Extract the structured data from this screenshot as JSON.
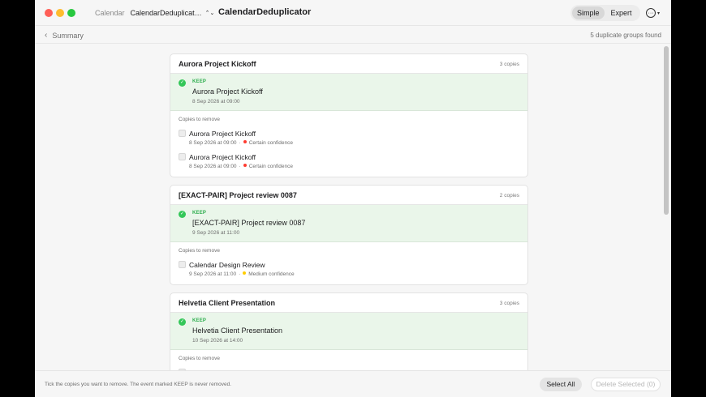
{
  "titlebar": {
    "calendar_label": "Calendar",
    "calendar_value": "CalendarDeduplicat…",
    "app_title": "CalendarDeduplicator",
    "modes": [
      "Simple",
      "Expert"
    ],
    "active_mode": "Simple",
    "more_icon": "ellipsis-circle-icon",
    "more_glyph": "···",
    "more_chevron": "▾",
    "updown_glyph": "⌃⌄"
  },
  "subheader": {
    "back_chevron": "‹",
    "back_label": "Summary",
    "groups_found": "5 duplicate groups found"
  },
  "groups": [
    {
      "title": "Aurora Project Kickoff",
      "copies": "3 copies",
      "keep": {
        "tag": "KEEP",
        "title": "Aurora Project Kickoff",
        "date": "8 Sep 2026 at 09:00"
      },
      "remove_label": "Copies to remove",
      "copies_to_remove": [
        {
          "title": "Aurora Project Kickoff",
          "date": "8 Sep 2026 at 09:00",
          "confidence": "Certain confidence"
        },
        {
          "title": "Aurora Project Kickoff",
          "date": "8 Sep 2026 at 09:00",
          "confidence": "Certain confidence"
        }
      ]
    },
    {
      "title": "[EXACT-PAIR] Project review 0087",
      "copies": "2 copies",
      "keep": {
        "tag": "KEEP",
        "title": "[EXACT-PAIR] Project review 0087",
        "date": "9 Sep 2026 at 11:00"
      },
      "remove_label": "Copies to remove",
      "copies_to_remove": [
        {
          "title": "Calendar Design Review",
          "date": "9 Sep 2026 at 11:00",
          "confidence": "Medium confidence"
        }
      ]
    },
    {
      "title": "Helvetia Client Presentation",
      "copies": "3 copies",
      "keep": {
        "tag": "KEEP",
        "title": "Helvetia Client Presentation",
        "date": "10 Sep 2026 at 14:00"
      },
      "remove_label": "Copies to remove",
      "copies_to_remove": []
    }
  ],
  "colors": {
    "certain": "#ff3b30",
    "medium": "#ffcc00",
    "keep_green": "#34c759"
  },
  "footer": {
    "note": "Tick the copies you want to remove. The event marked KEEP is never removed.",
    "select_all": "Select All",
    "delete_selected": "Delete Selected (0)"
  }
}
